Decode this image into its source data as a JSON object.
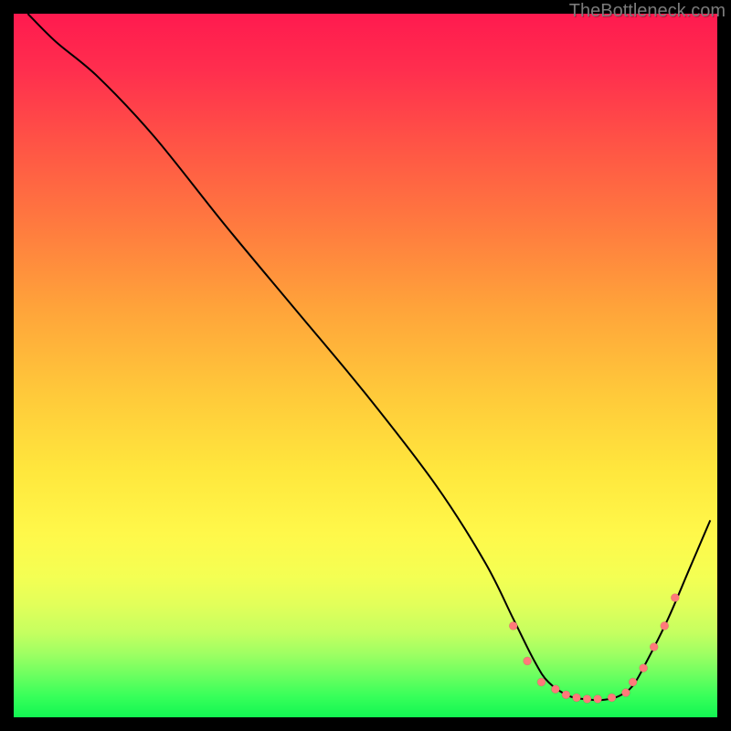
{
  "watermark": "TheBottleneck.com",
  "chart_data": {
    "type": "line",
    "title": "",
    "xlabel": "",
    "ylabel": "",
    "xlim": [
      0,
      100
    ],
    "ylim": [
      0,
      100
    ],
    "grid": false,
    "legend": false,
    "series": [
      {
        "name": "curve",
        "x": [
          2,
          6,
          12,
          20,
          30,
          40,
          50,
          60,
          67,
          71,
          74,
          76,
          79,
          82,
          84,
          86,
          88,
          90,
          93,
          96,
          99
        ],
        "y": [
          100,
          96,
          91,
          82.5,
          70,
          58,
          46,
          33,
          22,
          14,
          8,
          5,
          3,
          2.5,
          2.5,
          3,
          4.5,
          8,
          14,
          21,
          28
        ]
      }
    ],
    "markers": {
      "name": "dots",
      "x": [
        71,
        73,
        75,
        77,
        78.5,
        80,
        81.5,
        83,
        85,
        87,
        88,
        89.5,
        91,
        92.5,
        94
      ],
      "y": [
        13,
        8,
        5,
        4,
        3.2,
        2.8,
        2.6,
        2.6,
        2.8,
        3.5,
        5,
        7,
        10,
        13,
        17
      ]
    },
    "background_gradient": {
      "top": "#ff1a4f",
      "mid": "#ffe73d",
      "bottom": "#12f652"
    }
  }
}
